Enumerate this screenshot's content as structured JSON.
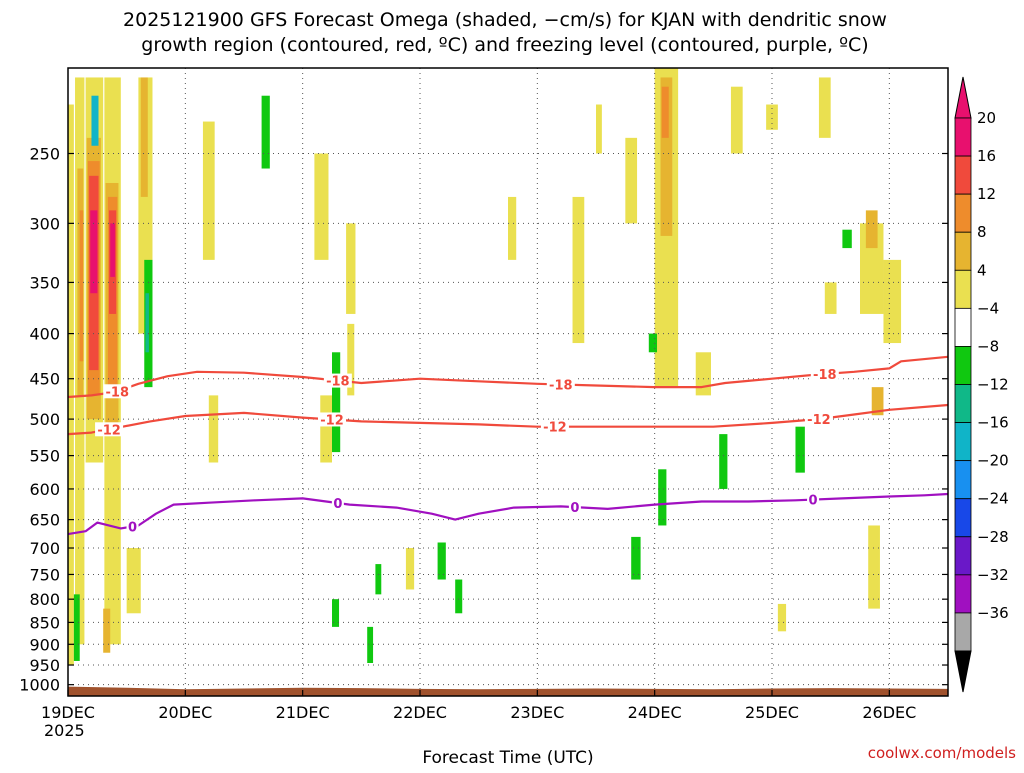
{
  "chart_data": {
    "type": "heatmap",
    "title_line1": "2025121900 GFS Forecast Omega (shaded, −cm/s) for KJAN with dendritic snow",
    "title_line2": "growth region (contoured, red, ºC) and freezing level (contoured, purple, ºC)",
    "xlabel": "Forecast Time (UTC)",
    "credit": "coolwx.com/models",
    "x_ticks": [
      {
        "day": 0,
        "label": "19DEC"
      },
      {
        "day": 1,
        "label": "20DEC"
      },
      {
        "day": 2,
        "label": "21DEC"
      },
      {
        "day": 3,
        "label": "22DEC"
      },
      {
        "day": 4,
        "label": "23DEC"
      },
      {
        "day": 5,
        "label": "24DEC"
      },
      {
        "day": 6,
        "label": "25DEC"
      },
      {
        "day": 7,
        "label": "26DEC"
      }
    ],
    "x_year_label": "2025",
    "xlim": [
      0,
      7.5
    ],
    "y_ticks": [
      250,
      300,
      350,
      400,
      450,
      500,
      550,
      600,
      650,
      700,
      750,
      800,
      850,
      900,
      950,
      1000
    ],
    "ylim": [
      1030,
      200
    ],
    "y_scale": "log-pressure",
    "grid": true,
    "colorbar": {
      "labels": [
        "20",
        "16",
        "12",
        "8",
        "4",
        "−4",
        "−8",
        "−12",
        "−16",
        "−20",
        "−24",
        "−28",
        "−32",
        "−36"
      ],
      "colors": [
        "#e8106e",
        "#f04a3c",
        "#ee8c2c",
        "#e6b430",
        "#eae050",
        "#ffffff",
        "#10c810",
        "#10b888",
        "#10b4c8",
        "#1890f0",
        "#1848e8",
        "#6a18c8",
        "#a010c0",
        "#a8a8a8"
      ],
      "top_color": "#e8106e",
      "bottom_color": "#000000"
    },
    "contours": [
      {
        "name": "-18",
        "color": "#f04a3c",
        "labels": [
          "-18",
          "-18",
          "-18",
          "-18"
        ],
        "label_days": [
          0.42,
          2.3,
          4.2,
          6.45
        ],
        "points": [
          [
            0,
            472
          ],
          [
            0.2,
            470
          ],
          [
            0.4,
            466
          ],
          [
            0.6,
            456
          ],
          [
            0.85,
            447
          ],
          [
            1.1,
            442
          ],
          [
            1.5,
            443
          ],
          [
            2.0,
            448
          ],
          [
            2.5,
            455
          ],
          [
            3.0,
            450
          ],
          [
            3.5,
            453
          ],
          [
            4.0,
            456
          ],
          [
            4.5,
            458
          ],
          [
            5.0,
            460
          ],
          [
            5.4,
            460
          ],
          [
            5.6,
            455
          ],
          [
            6.0,
            450
          ],
          [
            6.4,
            445
          ],
          [
            6.7,
            442
          ],
          [
            7.0,
            438
          ],
          [
            7.1,
            430
          ],
          [
            7.5,
            425
          ]
        ]
      },
      {
        "name": "-12",
        "color": "#f04a3c",
        "labels": [
          "-12",
          "-12",
          "-12",
          "-12"
        ],
        "label_days": [
          0.35,
          2.25,
          4.15,
          6.4
        ],
        "points": [
          [
            0,
            520
          ],
          [
            0.2,
            518
          ],
          [
            0.4,
            512
          ],
          [
            0.7,
            503
          ],
          [
            1.0,
            496
          ],
          [
            1.5,
            492
          ],
          [
            2.0,
            498
          ],
          [
            2.5,
            503
          ],
          [
            3.0,
            505
          ],
          [
            3.5,
            507
          ],
          [
            4.0,
            510
          ],
          [
            4.5,
            510
          ],
          [
            5.0,
            510
          ],
          [
            5.5,
            510
          ],
          [
            6.0,
            505
          ],
          [
            6.4,
            500
          ],
          [
            6.7,
            494
          ],
          [
            7.0,
            488
          ],
          [
            7.5,
            482
          ]
        ]
      },
      {
        "name": "0",
        "color": "#a010c0",
        "labels": [
          "0",
          "0",
          "0",
          "0"
        ],
        "label_days": [
          0.55,
          2.3,
          4.32,
          6.35
        ],
        "points": [
          [
            0,
            675
          ],
          [
            0.15,
            670
          ],
          [
            0.25,
            655
          ],
          [
            0.45,
            665
          ],
          [
            0.6,
            660
          ],
          [
            0.75,
            640
          ],
          [
            0.9,
            625
          ],
          [
            1.2,
            622
          ],
          [
            1.6,
            618
          ],
          [
            2.0,
            615
          ],
          [
            2.4,
            625
          ],
          [
            2.8,
            630
          ],
          [
            3.1,
            640
          ],
          [
            3.3,
            650
          ],
          [
            3.5,
            640
          ],
          [
            3.8,
            630
          ],
          [
            4.2,
            628
          ],
          [
            4.6,
            632
          ],
          [
            5.0,
            625
          ],
          [
            5.4,
            620
          ],
          [
            5.8,
            620
          ],
          [
            6.2,
            618
          ],
          [
            6.6,
            615
          ],
          [
            7.0,
            612
          ],
          [
            7.3,
            610
          ],
          [
            7.5,
            608
          ]
        ]
      }
    ],
    "shaded_regions": [
      {
        "day0": 0.0,
        "day1": 0.05,
        "p_top": 220,
        "p_bot": 950,
        "color": "#eae050"
      },
      {
        "day0": 0.06,
        "day1": 0.14,
        "p_top": 205,
        "p_bot": 900,
        "color": "#eae050"
      },
      {
        "day0": 0.08,
        "day1": 0.13,
        "p_top": 260,
        "p_bot": 470,
        "color": "#e6b430"
      },
      {
        "day0": 0.1,
        "day1": 0.13,
        "p_top": 290,
        "p_bot": 430,
        "color": "#ee8c2c"
      },
      {
        "day0": 0.15,
        "day1": 0.3,
        "p_top": 205,
        "p_bot": 560,
        "color": "#eae050"
      },
      {
        "day0": 0.16,
        "day1": 0.28,
        "p_top": 240,
        "p_bot": 500,
        "color": "#e6b430"
      },
      {
        "day0": 0.17,
        "day1": 0.27,
        "p_top": 255,
        "p_bot": 470,
        "color": "#ee8c2c"
      },
      {
        "day0": 0.18,
        "day1": 0.26,
        "p_top": 265,
        "p_bot": 440,
        "color": "#f04a3c"
      },
      {
        "day0": 0.19,
        "day1": 0.25,
        "p_top": 290,
        "p_bot": 360,
        "color": "#e8106e"
      },
      {
        "day0": 0.2,
        "day1": 0.26,
        "p_top": 215,
        "p_bot": 245,
        "color": "#10b4c8"
      },
      {
        "day0": 0.31,
        "day1": 0.45,
        "p_top": 205,
        "p_bot": 900,
        "color": "#eae050"
      },
      {
        "day0": 0.32,
        "day1": 0.43,
        "p_top": 270,
        "p_bot": 520,
        "color": "#e6b430"
      },
      {
        "day0": 0.34,
        "day1": 0.42,
        "p_top": 280,
        "p_bot": 460,
        "color": "#ee8c2c"
      },
      {
        "day0": 0.35,
        "day1": 0.41,
        "p_top": 290,
        "p_bot": 380,
        "color": "#f04a3c"
      },
      {
        "day0": 0.36,
        "day1": 0.4,
        "p_top": 300,
        "p_bot": 345,
        "color": "#e8106e"
      },
      {
        "day0": 0.3,
        "day1": 0.36,
        "p_top": 820,
        "p_bot": 920,
        "color": "#e6b430"
      },
      {
        "day0": 0.6,
        "day1": 0.72,
        "p_top": 205,
        "p_bot": 400,
        "color": "#eae050"
      },
      {
        "day0": 0.62,
        "day1": 0.68,
        "p_top": 205,
        "p_bot": 280,
        "color": "#e6b430"
      },
      {
        "day0": 0.65,
        "day1": 0.72,
        "p_top": 330,
        "p_bot": 460,
        "color": "#10c810"
      },
      {
        "day0": 0.66,
        "day1": 0.69,
        "p_top": 360,
        "p_bot": 420,
        "color": "#10b888"
      },
      {
        "day0": 0.05,
        "day1": 0.1,
        "p_top": 790,
        "p_bot": 940,
        "color": "#10c810"
      },
      {
        "day0": 0.5,
        "day1": 0.62,
        "p_top": 700,
        "p_bot": 830,
        "color": "#eae050"
      },
      {
        "day0": 1.15,
        "day1": 1.25,
        "p_top": 230,
        "p_bot": 330,
        "color": "#eae050"
      },
      {
        "day0": 1.2,
        "day1": 1.28,
        "p_top": 470,
        "p_bot": 560,
        "color": "#eae050"
      },
      {
        "day0": 1.65,
        "day1": 1.72,
        "p_top": 215,
        "p_bot": 260,
        "color": "#10c810"
      },
      {
        "day0": 2.1,
        "day1": 2.22,
        "p_top": 250,
        "p_bot": 330,
        "color": "#eae050"
      },
      {
        "day0": 2.15,
        "day1": 2.25,
        "p_top": 470,
        "p_bot": 560,
        "color": "#eae050"
      },
      {
        "day0": 2.25,
        "day1": 2.32,
        "p_top": 420,
        "p_bot": 545,
        "color": "#10c810"
      },
      {
        "day0": 2.37,
        "day1": 2.45,
        "p_top": 300,
        "p_bot": 380,
        "color": "#eae050"
      },
      {
        "day0": 2.38,
        "day1": 2.44,
        "p_top": 390,
        "p_bot": 470,
        "color": "#eae050"
      },
      {
        "day0": 2.25,
        "day1": 2.31,
        "p_top": 800,
        "p_bot": 860,
        "color": "#10c810"
      },
      {
        "day0": 2.55,
        "day1": 2.6,
        "p_top": 860,
        "p_bot": 945,
        "color": "#10c810"
      },
      {
        "day0": 2.62,
        "day1": 2.67,
        "p_top": 730,
        "p_bot": 790,
        "color": "#10c810"
      },
      {
        "day0": 3.15,
        "day1": 3.22,
        "p_top": 690,
        "p_bot": 760,
        "color": "#10c810"
      },
      {
        "day0": 3.3,
        "day1": 3.36,
        "p_top": 760,
        "p_bot": 830,
        "color": "#10c810"
      },
      {
        "day0": 2.88,
        "day1": 2.95,
        "p_top": 700,
        "p_bot": 780,
        "color": "#eae050"
      },
      {
        "day0": 3.75,
        "day1": 3.82,
        "p_top": 280,
        "p_bot": 330,
        "color": "#eae050"
      },
      {
        "day0": 4.3,
        "day1": 4.4,
        "p_top": 280,
        "p_bot": 410,
        "color": "#eae050"
      },
      {
        "day0": 4.75,
        "day1": 4.85,
        "p_top": 240,
        "p_bot": 300,
        "color": "#eae050"
      },
      {
        "day0": 4.5,
        "day1": 4.55,
        "p_top": 220,
        "p_bot": 250,
        "color": "#eae050"
      },
      {
        "day0": 5.05,
        "day1": 5.15,
        "p_top": 225,
        "p_bot": 360,
        "color": "#eae050"
      },
      {
        "day0": 5.0,
        "day1": 5.2,
        "p_top": 200,
        "p_bot": 460,
        "color": "#eae050"
      },
      {
        "day0": 5.05,
        "day1": 5.15,
        "p_top": 205,
        "p_bot": 310,
        "color": "#e6b430"
      },
      {
        "day0": 5.06,
        "day1": 5.12,
        "p_top": 210,
        "p_bot": 240,
        "color": "#ee8c2c"
      },
      {
        "day0": 5.03,
        "day1": 5.1,
        "p_top": 570,
        "p_bot": 660,
        "color": "#10c810"
      },
      {
        "day0": 4.8,
        "day1": 4.88,
        "p_top": 680,
        "p_bot": 760,
        "color": "#10c810"
      },
      {
        "day0": 4.95,
        "day1": 5.02,
        "p_top": 400,
        "p_bot": 420,
        "color": "#10c810"
      },
      {
        "day0": 5.35,
        "day1": 5.48,
        "p_top": 420,
        "p_bot": 470,
        "color": "#eae050"
      },
      {
        "day0": 5.55,
        "day1": 5.62,
        "p_top": 520,
        "p_bot": 600,
        "color": "#10c810"
      },
      {
        "day0": 5.65,
        "day1": 5.75,
        "p_top": 210,
        "p_bot": 250,
        "color": "#eae050"
      },
      {
        "day0": 5.95,
        "day1": 6.05,
        "p_top": 220,
        "p_bot": 235,
        "color": "#eae050"
      },
      {
        "day0": 6.2,
        "day1": 6.28,
        "p_top": 510,
        "p_bot": 575,
        "color": "#10c810"
      },
      {
        "day0": 6.05,
        "day1": 6.12,
        "p_top": 810,
        "p_bot": 870,
        "color": "#eae050"
      },
      {
        "day0": 6.4,
        "day1": 6.5,
        "p_top": 205,
        "p_bot": 240,
        "color": "#eae050"
      },
      {
        "day0": 6.45,
        "day1": 6.55,
        "p_top": 350,
        "p_bot": 380,
        "color": "#eae050"
      },
      {
        "day0": 6.6,
        "day1": 6.68,
        "p_top": 305,
        "p_bot": 320,
        "color": "#10c810"
      },
      {
        "day0": 6.8,
        "day1": 6.9,
        "p_top": 300,
        "p_bot": 340,
        "color": "#10c810"
      },
      {
        "day0": 6.75,
        "day1": 6.95,
        "p_top": 300,
        "p_bot": 380,
        "color": "#eae050"
      },
      {
        "day0": 6.8,
        "day1": 6.9,
        "p_top": 290,
        "p_bot": 320,
        "color": "#e6b430"
      },
      {
        "day0": 6.85,
        "day1": 6.95,
        "p_top": 460,
        "p_bot": 495,
        "color": "#e6b430"
      },
      {
        "day0": 6.82,
        "day1": 6.92,
        "p_top": 660,
        "p_bot": 820,
        "color": "#eae050"
      },
      {
        "day0": 6.95,
        "day1": 7.1,
        "p_top": 330,
        "p_bot": 410,
        "color": "#eae050"
      }
    ],
    "terrain": {
      "color": "#a0522d",
      "points": [
        [
          0,
          1005
        ],
        [
          0.5,
          1008
        ],
        [
          1.0,
          1012
        ],
        [
          1.5,
          1010
        ],
        [
          2.0,
          1008
        ],
        [
          2.5,
          1009
        ],
        [
          3.0,
          1011
        ],
        [
          3.5,
          1012
        ],
        [
          4.0,
          1011
        ],
        [
          4.5,
          1010
        ],
        [
          5.0,
          1011
        ],
        [
          5.5,
          1012
        ],
        [
          6.0,
          1010
        ],
        [
          6.5,
          1009
        ],
        [
          7.0,
          1010
        ],
        [
          7.5,
          1011
        ]
      ]
    }
  }
}
